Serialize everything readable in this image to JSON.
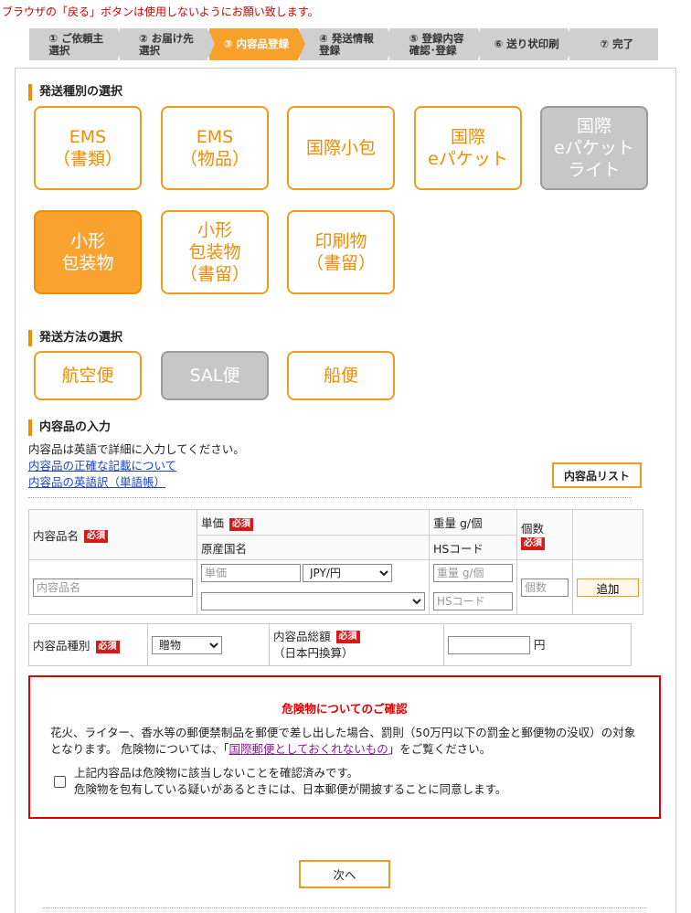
{
  "top_warning": "ブラウザの「戻る」ボタンは使用しないようにお願い致します。",
  "steps": [
    {
      "label": "① ご依頼主\n選択"
    },
    {
      "label": "② お届け先\n選択"
    },
    {
      "label": "③ 内容品登録",
      "active": true
    },
    {
      "label": "④ 発送情報\n登録"
    },
    {
      "label": "⑤ 登録内容\n確認･登録"
    },
    {
      "label": "⑥ 送り状印刷"
    },
    {
      "label": "⑦ 完了"
    }
  ],
  "shipping_type": {
    "heading": "発送種別の選択",
    "options": [
      {
        "label": "EMS\n（書類）"
      },
      {
        "label": "EMS\n（物品）"
      },
      {
        "label": "国際小包"
      },
      {
        "label": "国際\neパケット"
      },
      {
        "label": "国際\neパケット\nライト",
        "state": "disabled"
      },
      {
        "label": "小形\n包装物",
        "state": "selected"
      },
      {
        "label": "小形\n包装物\n（書留）"
      },
      {
        "label": "印刷物\n（書留）"
      }
    ]
  },
  "shipping_method": {
    "heading": "発送方法の選択",
    "options": [
      {
        "label": "航空便"
      },
      {
        "label": "SAL便",
        "state": "disabled"
      },
      {
        "label": "船便"
      }
    ]
  },
  "contents": {
    "heading": "内容品の入力",
    "note": "内容品は英語で詳細に入力してください。",
    "link_accurate": "内容品の正確な記載について",
    "link_dictionary": "内容品の英語訳（単語帳）",
    "list_button": "内容品リスト"
  },
  "item_table": {
    "name_header": "内容品名",
    "price_header": "単価",
    "origin_header": "原産国名",
    "weight_header": "重量 g/個",
    "hs_header": "HSコード",
    "qty_header": "個数",
    "required": "必須",
    "name_placeholder": "内容品名",
    "price_placeholder": "単価",
    "currency_value": "JPY/円",
    "origin_value": "",
    "weight_placeholder": "重量 g/個",
    "hs_placeholder": "HSコード",
    "qty_placeholder": "個数",
    "add_button": "追加"
  },
  "kind_table": {
    "kind_label": "内容品種別",
    "kind_value": "贈物",
    "total_label": "内容品総額",
    "total_sub": "（日本円換算）",
    "total_value": "",
    "yen": "円",
    "required": "必須"
  },
  "danger": {
    "title": "危険物についてのご確認",
    "body_1": "花火、ライター、香水等の郵便禁制品を郵便で差し出した場合、罰則（50万円以下の罰金と郵便物の没収）の対象となります。 危険物については、「",
    "body_link": "国際郵便としておくれないもの",
    "body_2": "」をご覧ください。",
    "check_text": "上記内容品は危険物に該当しないことを確認済みです。\n危険物を包有している疑いがあるときには、日本郵便が開披することに同意します。"
  },
  "next_button": "次へ"
}
